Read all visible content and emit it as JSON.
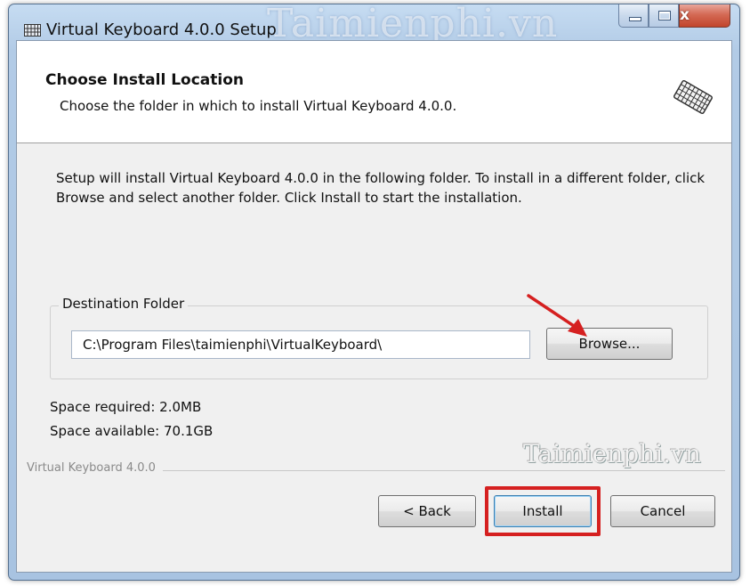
{
  "window": {
    "title": "Virtual Keyboard 4.0.0 Setup",
    "watermark_top": "Taimienphi.vn",
    "caption": {
      "minimize_icon": "minimize-icon",
      "maximize_icon": "maximize-icon",
      "close_label": "x"
    }
  },
  "header": {
    "title": "Choose Install Location",
    "subtitle": "Choose the folder in which to install Virtual Keyboard 4.0.0.",
    "icon": "keyboard-icon"
  },
  "body": {
    "description": "Setup will install Virtual Keyboard 4.0.0 in the following folder. To install in a different folder, click Browse and select another folder. Click Install to start the installation.",
    "destination": {
      "legend": "Destination Folder",
      "path": "C:\\Program Files\\taimienphi\\VirtualKeyboard\\",
      "browse_label": "Browse..."
    },
    "space_required": "Space required: 2.0MB",
    "space_available": "Space available: 70.1GB"
  },
  "footer": {
    "brand": "Virtual Keyboard 4.0.0",
    "watermark": "Taimienphi.vn",
    "back_label": "< Back",
    "install_label": "Install",
    "cancel_label": "Cancel"
  },
  "colors": {
    "highlight": "#d52020",
    "arrow": "#d52020"
  }
}
